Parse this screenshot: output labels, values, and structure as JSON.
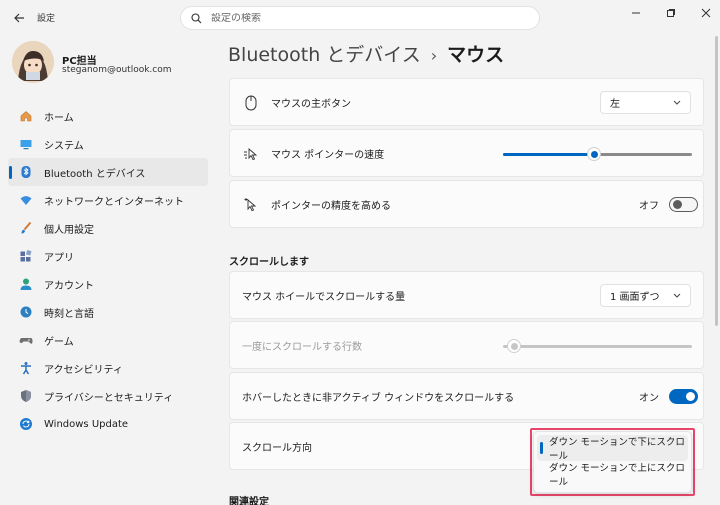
{
  "window": {
    "app_title": "設定",
    "search_placeholder": "設定の検索"
  },
  "profile": {
    "name": "PC担当",
    "email": "steganom@outlook.com"
  },
  "sidebar": {
    "items": [
      {
        "label": "ホーム",
        "icon": "home-icon",
        "color": "#e07a2e"
      },
      {
        "label": "システム",
        "icon": "system-icon",
        "color": "#2a8fd8"
      },
      {
        "label": "Bluetooth とデバイス",
        "icon": "bluetooth-icon",
        "color": "#2a7ad0",
        "active": true
      },
      {
        "label": "ネットワークとインターネット",
        "icon": "wifi-icon",
        "color": "#3a8ee0"
      },
      {
        "label": "個人用設定",
        "icon": "brush-icon",
        "color": "#d06a2a"
      },
      {
        "label": "アプリ",
        "icon": "apps-icon",
        "color": "#5a6fa0"
      },
      {
        "label": "アカウント",
        "icon": "account-icon",
        "color": "#2aa27a"
      },
      {
        "label": "時刻と言語",
        "icon": "clock-globe-icon",
        "color": "#2a80c0"
      },
      {
        "label": "ゲーム",
        "icon": "gamepad-icon",
        "color": "#6a6a6a"
      },
      {
        "label": "アクセシビリティ",
        "icon": "accessibility-icon",
        "color": "#2a6fc0"
      },
      {
        "label": "プライバシーとセキュリティ",
        "icon": "shield-icon",
        "color": "#6a7080"
      },
      {
        "label": "Windows Update",
        "icon": "update-icon",
        "color": "#1f7ad0"
      }
    ]
  },
  "breadcrumb": {
    "parent": "Bluetooth とデバイス",
    "separator": "›",
    "current": "マウス"
  },
  "settings": {
    "primary_button": {
      "label": "マウスの主ボタン",
      "value": "左"
    },
    "pointer_speed": {
      "label": "マウス ポインターの速度",
      "level": 0.48
    },
    "enhance_precision": {
      "label": "ポインターの精度を高める",
      "state": "オフ"
    }
  },
  "scroll_section": {
    "title": "スクロールします",
    "wheel_amount": {
      "label": "マウス ホイールでスクロールする量",
      "value": "1 画面ずつ"
    },
    "lines_at_a_time": {
      "label": "一度にスクロールする行数",
      "level": 0.06
    },
    "scroll_inactive": {
      "label": "ホバーしたときに非アクティブ ウィンドウをスクロールする",
      "state": "オン"
    },
    "scroll_direction": {
      "label": "スクロール方向",
      "options": [
        "ダウン モーションで下にスクロール",
        "ダウン モーションで上にスクロール"
      ],
      "selected_index": 0
    }
  },
  "related_section": {
    "title": "関連設定"
  },
  "colors": {
    "accent": "#0067c0",
    "highlight_box": "#e8476b"
  }
}
